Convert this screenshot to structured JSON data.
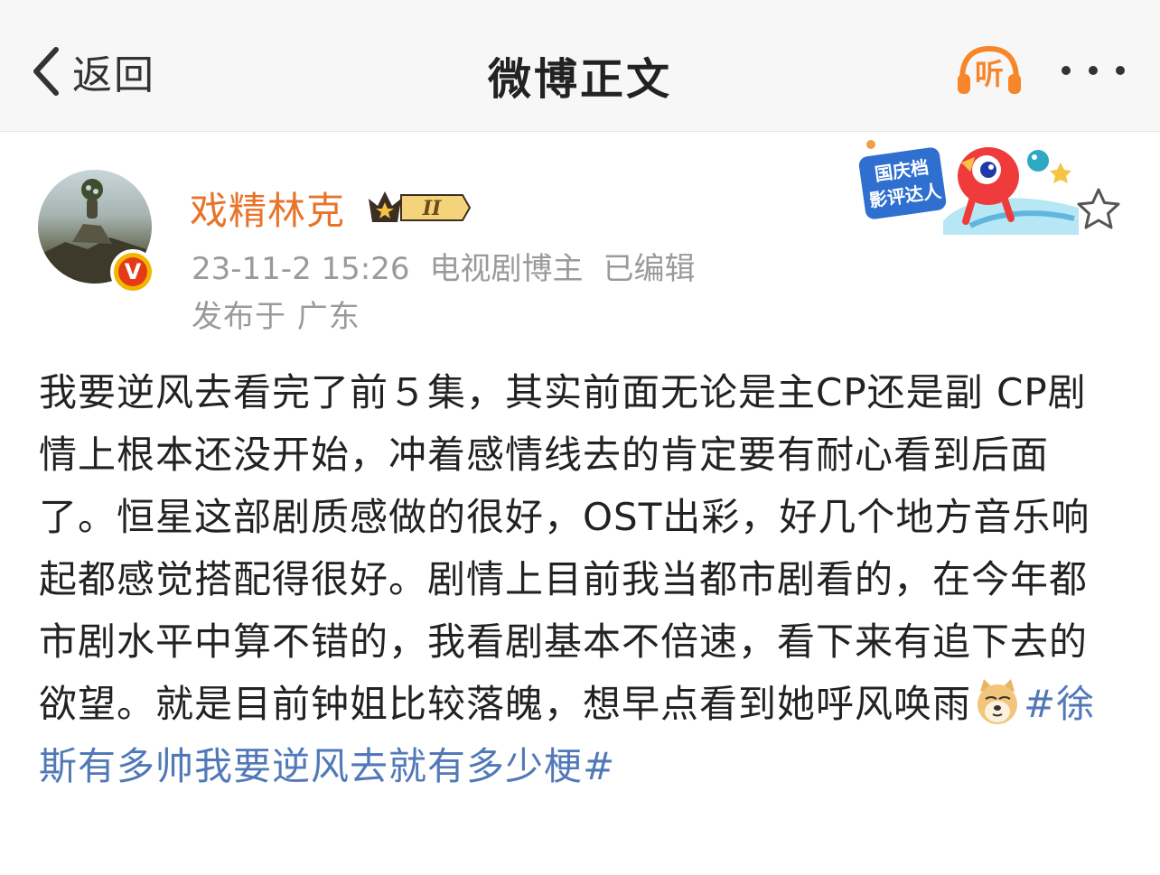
{
  "navbar": {
    "back_label": "返回",
    "title": "微博正文",
    "listen_label": "听",
    "accent_color": "#f7862a"
  },
  "author": {
    "name": "戏精林克",
    "name_color": "#e8742b",
    "level_badge": "II",
    "verified_mark": "V"
  },
  "meta": {
    "timestamp": "23-11-2 15:26",
    "source": "电视剧博主",
    "edited": "已编辑",
    "location": "发布于 广东"
  },
  "sticker": {
    "line1": "国庆档",
    "line2": "影评达人"
  },
  "post": {
    "text": "我要逆风去看完了前５集，其实前面无论是主CP还是副 CP剧情上根本还没开始，冲着感情线去的肯定要有耐心看到后面了。恒星这部剧质感做的很好，OST出彩，好几个地方音乐响起都感觉搭配得很好。剧情上目前我当都市剧看的，在今年都市剧水平中算不错的，我看剧基本不倍速，看下来有追下去的欲望。就是目前钟姐比较落魄，想早点看到她呼风唤雨",
    "emoji": "doge-icon",
    "topic": "#徐斯有多帅我要逆风去就有多少梗#",
    "topic_color": "#5179b8"
  }
}
